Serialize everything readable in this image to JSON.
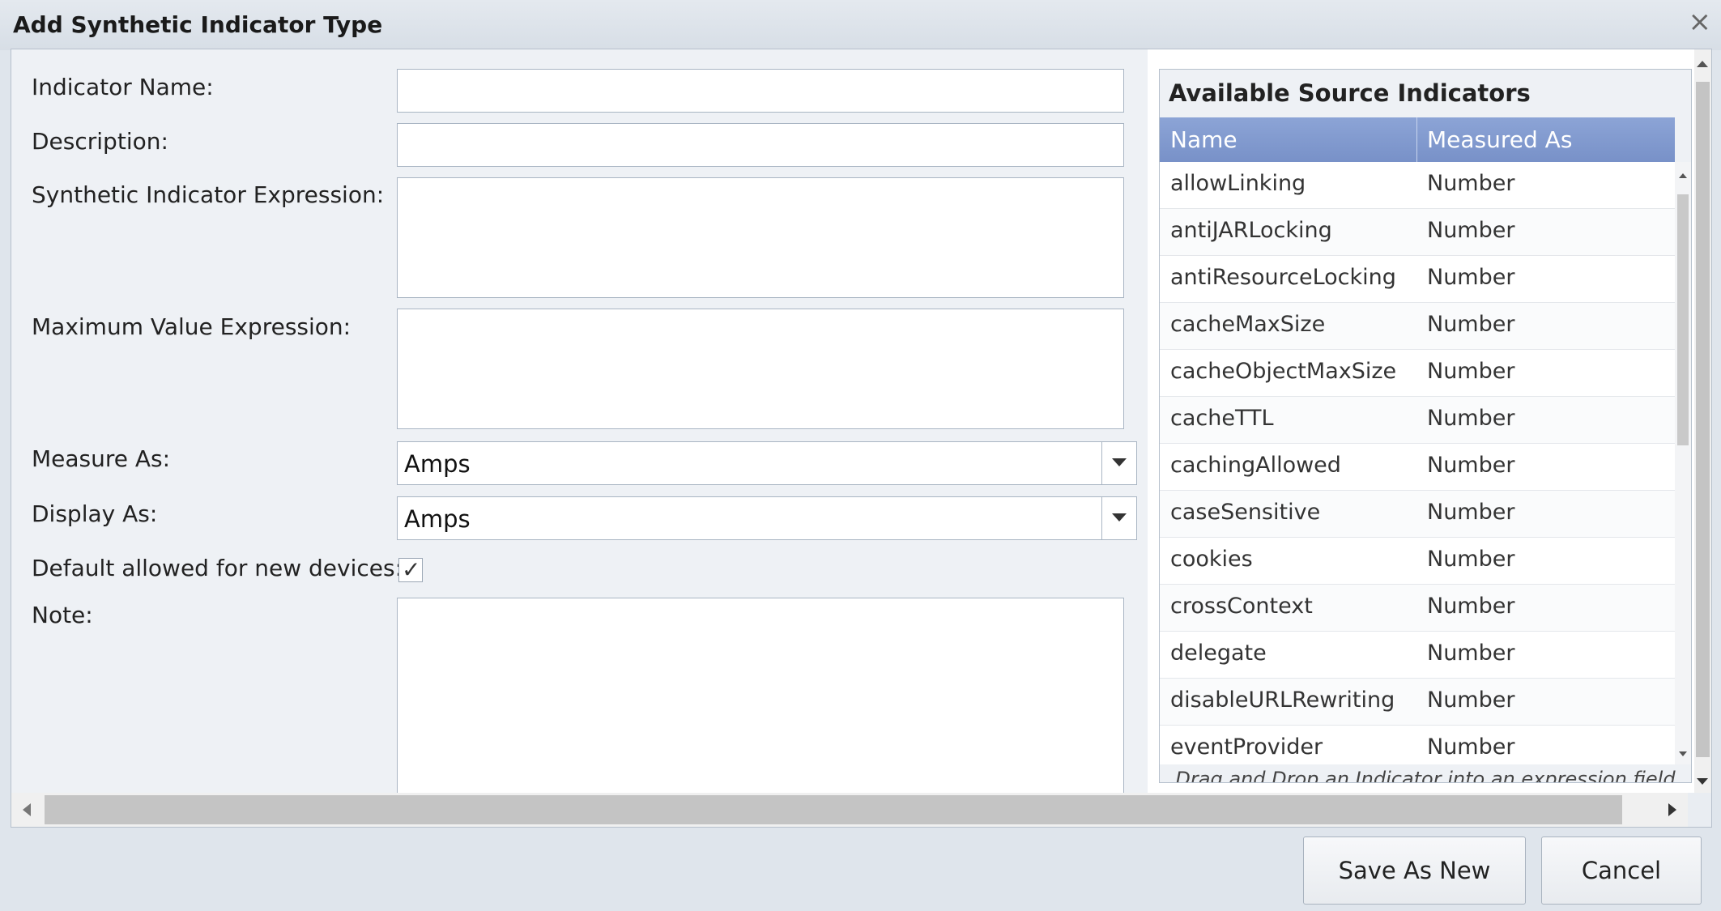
{
  "dialog": {
    "title": "Add Synthetic Indicator Type",
    "close_glyph": "×"
  },
  "form": {
    "indicator_name_label": "Indicator Name:",
    "indicator_name_value": "",
    "description_label": "Description:",
    "description_value": "",
    "expression_label": "Synthetic Indicator Expression:",
    "expression_value": "",
    "max_value_label": "Maximum Value Expression:",
    "max_value_value": "",
    "measure_as_label": "Measure As:",
    "measure_as_value": "Amps",
    "display_as_label": "Display As:",
    "display_as_value": "Amps",
    "default_allowed_label": "Default allowed for new devices:",
    "default_allowed_checked": true,
    "note_label": "Note:",
    "note_value": ""
  },
  "source_panel": {
    "title": "Available Source Indicators",
    "columns": [
      "Name",
      "Measured As"
    ],
    "rows": [
      {
        "name": "allowLinking",
        "measured_as": "Number"
      },
      {
        "name": "antiJARLocking",
        "measured_as": "Number"
      },
      {
        "name": "antiResourceLocking",
        "measured_as": "Number"
      },
      {
        "name": "cacheMaxSize",
        "measured_as": "Number"
      },
      {
        "name": "cacheObjectMaxSize",
        "measured_as": "Number"
      },
      {
        "name": "cacheTTL",
        "measured_as": "Number"
      },
      {
        "name": "cachingAllowed",
        "measured_as": "Number"
      },
      {
        "name": "caseSensitive",
        "measured_as": "Number"
      },
      {
        "name": "cookies",
        "measured_as": "Number"
      },
      {
        "name": "crossContext",
        "measured_as": "Number"
      },
      {
        "name": "delegate",
        "measured_as": "Number"
      },
      {
        "name": "disableURLRewriting",
        "measured_as": "Number"
      },
      {
        "name": "eventProvider",
        "measured_as": "Number"
      }
    ],
    "hint": "Drag and Drop an Indicator into an expression field"
  },
  "buttons": {
    "save_as_new": "Save As New",
    "cancel": "Cancel"
  }
}
